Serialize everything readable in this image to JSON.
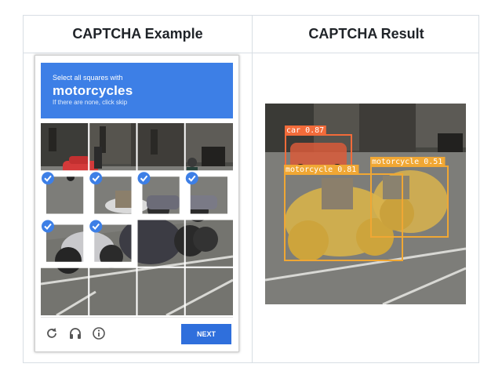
{
  "headers": {
    "left": "CAPTCHA Example",
    "right": "CAPTCHA Result"
  },
  "captcha": {
    "prompt": "Select all squares with",
    "target": "motorcycles",
    "hint": "If there are none, click skip",
    "next_label": "NEXT",
    "selected_tiles": [
      [
        1,
        0
      ],
      [
        1,
        1
      ],
      [
        1,
        2
      ],
      [
        1,
        3
      ],
      [
        2,
        0
      ],
      [
        2,
        1
      ]
    ],
    "footer_icons": [
      "reload-icon",
      "audio-icon",
      "info-icon"
    ]
  },
  "detections": [
    {
      "class": "car",
      "score": "0.87",
      "color": "#f26b3a"
    },
    {
      "class": "motorcycle",
      "score": "0.81",
      "color": "#f0a734"
    },
    {
      "class": "motorcycle",
      "score": "0.51",
      "color": "#f0a734"
    }
  ],
  "colors": {
    "captcha_blue": "#3d7fe6",
    "next_button": "#2f6fdc",
    "check_badge": "#3d7fe6",
    "border": "#d8dee4"
  }
}
